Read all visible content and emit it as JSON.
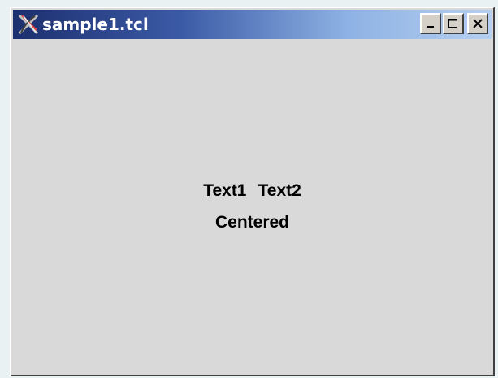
{
  "window": {
    "title": "sample1.tcl",
    "icon": "tk-feather-icon",
    "controls": [
      "minimize",
      "maximize",
      "close"
    ]
  },
  "labels": {
    "text1": "Text1",
    "text2": "Text2",
    "centered": "Centered"
  },
  "colors": {
    "titlebar_start": "#1c2f6e",
    "titlebar_end": "#b5cff0",
    "background": "#d9d9d9",
    "text": "#000000"
  }
}
